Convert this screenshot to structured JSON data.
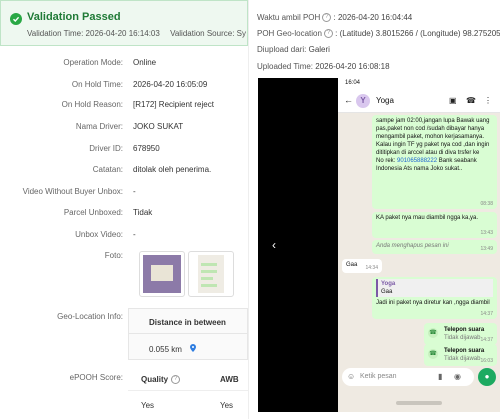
{
  "banner": {
    "title": "Validation Passed",
    "validation_time": "Validation Time: 2026-04-20 16:14:03",
    "validation_source": "Validation Source: Sy"
  },
  "details": {
    "operation_mode": {
      "label": "Operation Mode:",
      "value": "Online"
    },
    "on_hold_time": {
      "label": "On Hold Time:",
      "value": "2026-04-20 16:05:09"
    },
    "on_hold_reason": {
      "label": "On Hold Reason:",
      "value": "[R172] Recipient reject"
    },
    "nama_driver": {
      "label": "Nama Driver:",
      "value": "JOKO SUKAT"
    },
    "driver_id": {
      "label": "Driver ID:",
      "value": "678950"
    },
    "catatan": {
      "label": "Catatan:",
      "value": "ditolak oleh penerima."
    },
    "video_without_buyer_unbox": {
      "label": "Video Without Buyer Unbox:",
      "value": "-"
    },
    "parcel_unboxed": {
      "label": "Parcel Unboxed:",
      "value": "Tidak"
    },
    "unbox_video": {
      "label": "Unbox Video:",
      "value": "-"
    },
    "foto": {
      "label": "Foto:"
    },
    "geo_location": {
      "label": "Geo-Location Info:",
      "header": "Distance in between",
      "distance": "0.055 km"
    },
    "epooh": {
      "label": "ePOOH Score:",
      "quality_header": "Quality",
      "awb_header": "AWB",
      "quality_value": "Yes",
      "awb_value": "Yes"
    }
  },
  "poh": {
    "waktu_label": "Waktu ambil POH",
    "waktu_value": ": 2026-04-20 16:04:44",
    "geo_label": "POH Geo-location",
    "geo_value": ": (Latitude) 3.8015266 / (Longitude) 98.275205",
    "diupload_label": "Diupload dari:",
    "diupload_value": "Galeri",
    "uploaded_label": "Uploaded Time:",
    "uploaded_value": "2026-04-20 16:08:18"
  },
  "chat": {
    "status_time": "16:04",
    "contact_initial": "Y",
    "contact_name": "Yoga",
    "msg1": "sampe jam 02:00,jangan lupa Bawak uang pas,paket non cod /sudah dibayar hanya mengambil paket, mohon kerjasamanya.",
    "msg1b": "Kalau ingin TF yg paket nya cod ,dan ingin dititipkan di arccel atau di diva trsfer ke",
    "msg1c_prefix": "No rek: ",
    "msg1c_link": "901065888222",
    "msg1c_suffix": " Bank seabank Indonesia Ats nama Joko sukat..",
    "msg1_time": "08:38",
    "msg2": "KA paket nya mau diambil ngga ka,ya.",
    "msg2_time": "13:43",
    "deleted": "Anda menghapus pesan ini",
    "deleted_time": "13:49",
    "msg3": "Gaa",
    "msg3_time": "14:34",
    "quote_name": "Yoga",
    "quote_text": "Gaa",
    "msg4": "Jadi ini paket nya diretur kan ,ngga diambil",
    "msg4_time": "14:37",
    "call1_title": "Telepon suara",
    "call1_status": "Tidak dijawab",
    "call1_time": "14:37",
    "call2_title": "Telepon suara",
    "call2_status": "Tidak dijawab",
    "call2_time": "16:03",
    "input_placeholder": "Ketik pesan"
  },
  "icons": {
    "check": "check-circle-icon",
    "help": "question-circle-icon",
    "pin": "location-pin-icon",
    "prev": "chevron-left-icon"
  },
  "colors": {
    "success": "#29a845",
    "whatsapp_green": "#1daa61",
    "link": "#1e66d0"
  }
}
